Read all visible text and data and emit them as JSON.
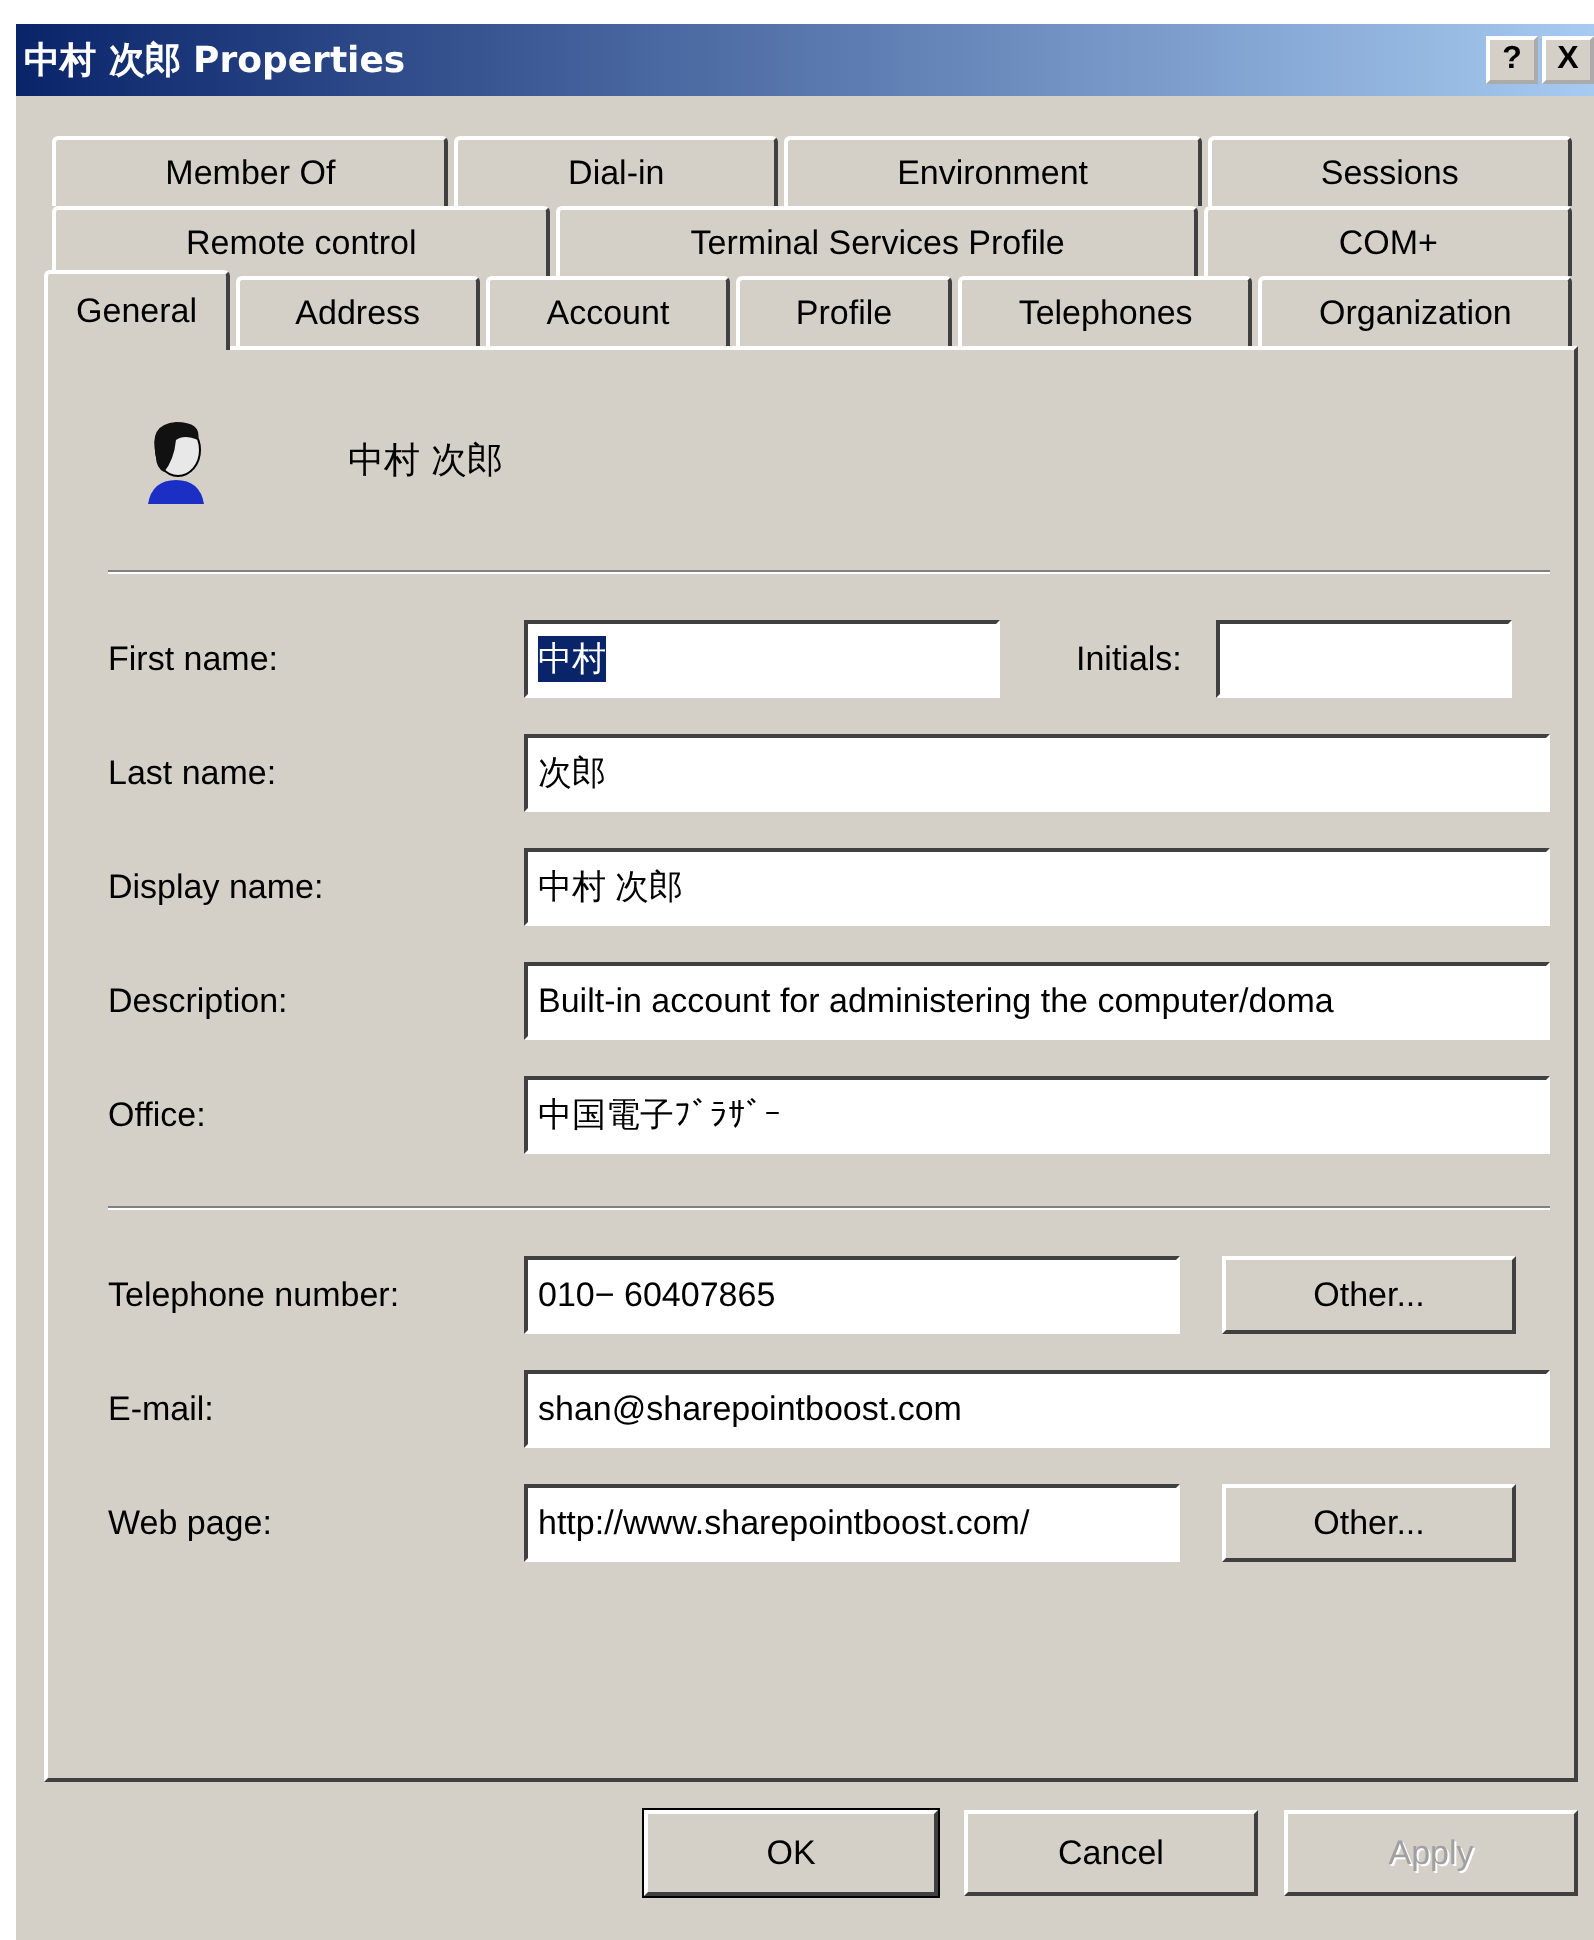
{
  "window": {
    "title": "中村 次郎 Properties",
    "title_buttons": [
      "?",
      "X"
    ]
  },
  "tab_rows": [
    [
      {
        "label": "Member Of",
        "selected": false
      },
      {
        "label": "Dial-in",
        "selected": false
      },
      {
        "label": "Environment",
        "selected": false
      },
      {
        "label": "Sessions",
        "selected": false
      }
    ],
    [
      {
        "label": "Remote control",
        "selected": false
      },
      {
        "label": "Terminal Services Profile",
        "selected": false
      },
      {
        "label": "COM+",
        "selected": false
      }
    ],
    [
      {
        "label": "General",
        "selected": true
      },
      {
        "label": "Address",
        "selected": false
      },
      {
        "label": "Account",
        "selected": false
      },
      {
        "label": "Profile",
        "selected": false
      },
      {
        "label": "Telephones",
        "selected": false
      },
      {
        "label": "Organization",
        "selected": false
      }
    ]
  ],
  "user": {
    "name": "中村 次郎"
  },
  "sections": [
    [
      {
        "label": "First name:",
        "value": "中村",
        "text_selected": true,
        "extra": {
          "label": "Initials:"
        }
      },
      {
        "label": "Last name:",
        "value": "次郎",
        "text_selected": false
      },
      {
        "label": "Display name:",
        "value": "中村 次郎",
        "text_selected": false
      },
      {
        "label": "Description:",
        "value": "Built-in account for administering the computer/doma",
        "text_selected": false
      },
      {
        "label": "Office:",
        "value": "中国電子ﾌﾞﾗｻﾞｰ",
        "text_selected": false
      }
    ],
    [
      {
        "label": "Telephone number:",
        "value": "010− 60407865",
        "text_selected": false,
        "button": {
          "label": "Other..."
        }
      },
      {
        "label": "E-mail:",
        "value": "shan@sharepointboost.com",
        "text_selected": false
      },
      {
        "label": "Web page:",
        "value": "http://www.sharepointboost.com/",
        "text_selected": false,
        "button": {
          "label": "Other..."
        }
      }
    ]
  ],
  "buttons": [
    {
      "label": "OK",
      "default": true,
      "disabled": false
    },
    {
      "label": "Cancel",
      "default": false,
      "disabled": false
    },
    {
      "label": "Apply",
      "default": false,
      "disabled": true
    }
  ]
}
